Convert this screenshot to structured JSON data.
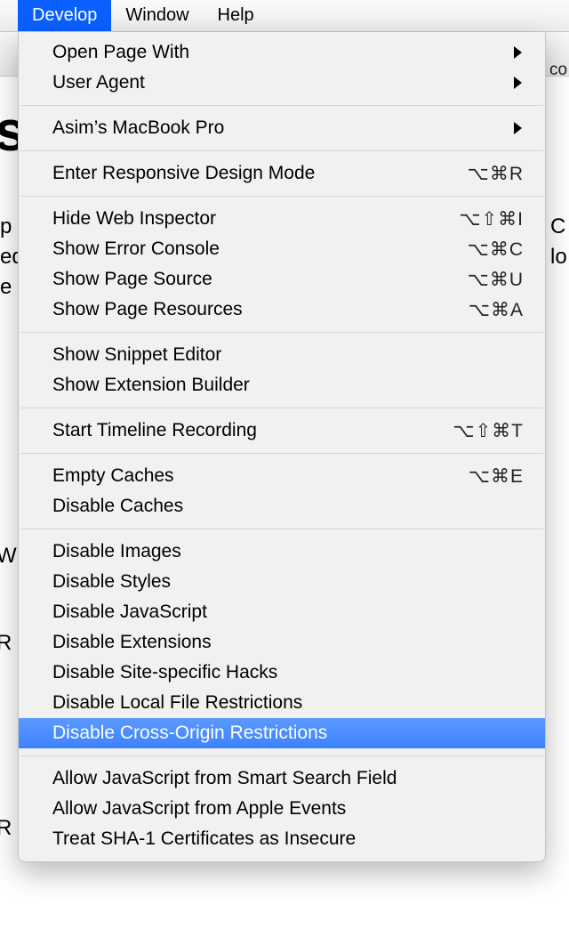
{
  "menubar": {
    "items": [
      {
        "label": "Develop",
        "active": true
      },
      {
        "label": "Window",
        "active": false
      },
      {
        "label": "Help",
        "active": false
      }
    ]
  },
  "background": {
    "title_fragment": "st",
    "url_fragment": "co",
    "p_col_left": "p\ned\ne",
    "p_col_right": "C\nlo",
    "w_fragment": "W",
    "r1_fragment": "R",
    "r2_fragment": "R"
  },
  "menu": {
    "groups": [
      [
        {
          "label": "Open Page With",
          "submenu": true
        },
        {
          "label": "User Agent",
          "submenu": true
        }
      ],
      [
        {
          "label": "Asim’s MacBook Pro",
          "submenu": true
        }
      ],
      [
        {
          "label": "Enter Responsive Design Mode",
          "shortcut": "⌥⌘R"
        }
      ],
      [
        {
          "label": "Hide Web Inspector",
          "shortcut": "⌥⇧⌘I"
        },
        {
          "label": "Show Error Console",
          "shortcut": "⌥⌘C"
        },
        {
          "label": "Show Page Source",
          "shortcut": "⌥⌘U"
        },
        {
          "label": "Show Page Resources",
          "shortcut": "⌥⌘A"
        }
      ],
      [
        {
          "label": "Show Snippet Editor"
        },
        {
          "label": "Show Extension Builder"
        }
      ],
      [
        {
          "label": "Start Timeline Recording",
          "shortcut": "⌥⇧⌘T"
        }
      ],
      [
        {
          "label": "Empty Caches",
          "shortcut": "⌥⌘E"
        },
        {
          "label": "Disable Caches"
        }
      ],
      [
        {
          "label": "Disable Images"
        },
        {
          "label": "Disable Styles"
        },
        {
          "label": "Disable JavaScript"
        },
        {
          "label": "Disable Extensions"
        },
        {
          "label": "Disable Site-specific Hacks"
        },
        {
          "label": "Disable Local File Restrictions"
        },
        {
          "label": "Disable Cross-Origin Restrictions",
          "highlight": true
        }
      ],
      [
        {
          "label": "Allow JavaScript from Smart Search Field"
        },
        {
          "label": "Allow JavaScript from Apple Events"
        },
        {
          "label": "Treat SHA-1 Certificates as Insecure"
        }
      ]
    ]
  }
}
